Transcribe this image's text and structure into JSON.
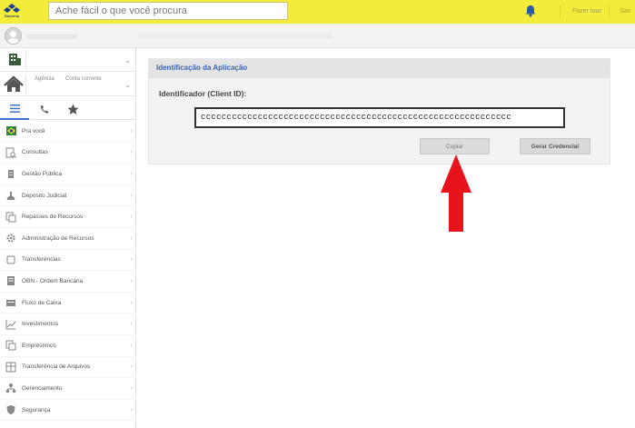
{
  "topbar": {
    "logo_text": "Governo",
    "search_placeholder": "Ache fácil o que você procura",
    "tour_label": "Fazer tour",
    "exit_label": "Sair"
  },
  "sidebar": {
    "selector_2_tabs": [
      "Agência",
      "Conta corrente"
    ],
    "menu": [
      {
        "label": "Pra você",
        "icon": "brazil-flag-icon"
      },
      {
        "label": "Consultas",
        "icon": "search-doc-icon"
      },
      {
        "label": "Gestão Pública",
        "icon": "building-icon"
      },
      {
        "label": "Depósito Judicial",
        "icon": "scale-icon"
      },
      {
        "label": "Repasses de Recursos",
        "icon": "transfer-doc-icon"
      },
      {
        "label": "Administração de Recursos",
        "icon": "gear-icon"
      },
      {
        "label": "Transferências",
        "icon": "transfer-icon"
      },
      {
        "label": "OBN - Ordem Bancária",
        "icon": "document-icon"
      },
      {
        "label": "Fluxo de Caixa",
        "icon": "cash-icon"
      },
      {
        "label": "Investimentos",
        "icon": "chart-icon"
      },
      {
        "label": "Empréstimos",
        "icon": "loan-icon"
      },
      {
        "label": "Transferência de Arquivos",
        "icon": "files-icon"
      },
      {
        "label": "Gerenciamento",
        "icon": "org-icon"
      },
      {
        "label": "Segurança",
        "icon": "shield-icon"
      }
    ]
  },
  "panel": {
    "title": "Identificação da Aplicação",
    "id_label": "Identificador (Client ID):",
    "client_id": "cccccccccccccccccccccccccccccccccccccccccccccccccccccccccccc",
    "copy_button": "Copiar",
    "generate_button": "Gerar Credencial"
  },
  "colors": {
    "topbar": "#f4ec3a",
    "title_blue": "#3964b3",
    "arrow_red": "#e8141c"
  }
}
